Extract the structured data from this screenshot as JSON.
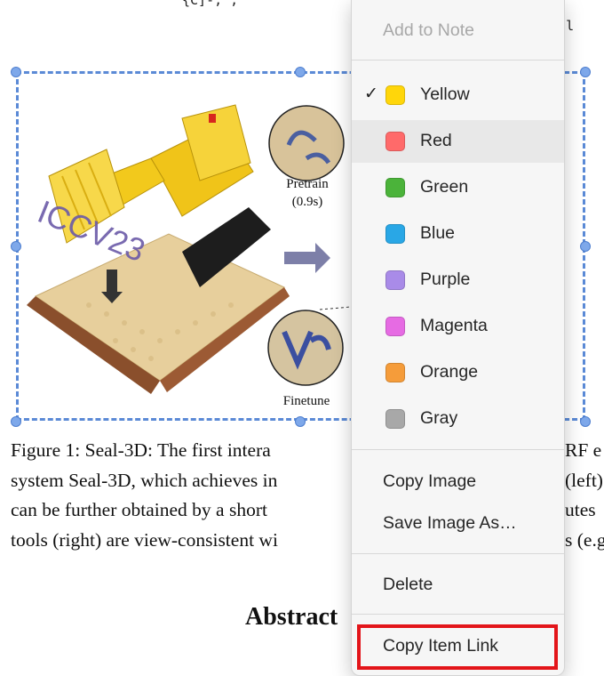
{
  "document": {
    "top_snippet": "{C]-; ,",
    "top_right_snippet": "ngzl",
    "figure": {
      "label_pretrain": "Pretrain",
      "label_pretrain_time": "(0.9s)",
      "label_finetune": "Finetune",
      "overlay_text": "ICCV23"
    },
    "caption_lines": [
      "Figure 1:  Seal-3D: The first intera",
      "system Seal-3D, which achieves in",
      "can be further obtained by a short",
      "tools (right) are view-consistent wi"
    ],
    "caption_right_fragments": [
      "RF e",
      "(left)",
      "utes",
      "s (e.g"
    ],
    "abstract_heading": "Abstract"
  },
  "context_menu": {
    "add_to_note": "Add to Note",
    "colors": [
      {
        "label": "Yellow",
        "color": "#ffd60a",
        "checked": true
      },
      {
        "label": "Red",
        "color": "#ff6a6a",
        "checked": false
      },
      {
        "label": "Green",
        "color": "#4bb33a",
        "checked": false
      },
      {
        "label": "Blue",
        "color": "#29a7e6",
        "checked": false
      },
      {
        "label": "Purple",
        "color": "#a98be8",
        "checked": false
      },
      {
        "label": "Magenta",
        "color": "#e66be3",
        "checked": false
      },
      {
        "label": "Orange",
        "color": "#f59c3a",
        "checked": false
      },
      {
        "label": "Gray",
        "color": "#a8a8a8",
        "checked": false
      }
    ],
    "checkmark": "✓",
    "copy_image": "Copy Image",
    "save_image_as": "Save Image As…",
    "delete": "Delete",
    "copy_item_link": "Copy Item Link",
    "hovered_item": "Red",
    "highlight_color": "#e3151a"
  }
}
